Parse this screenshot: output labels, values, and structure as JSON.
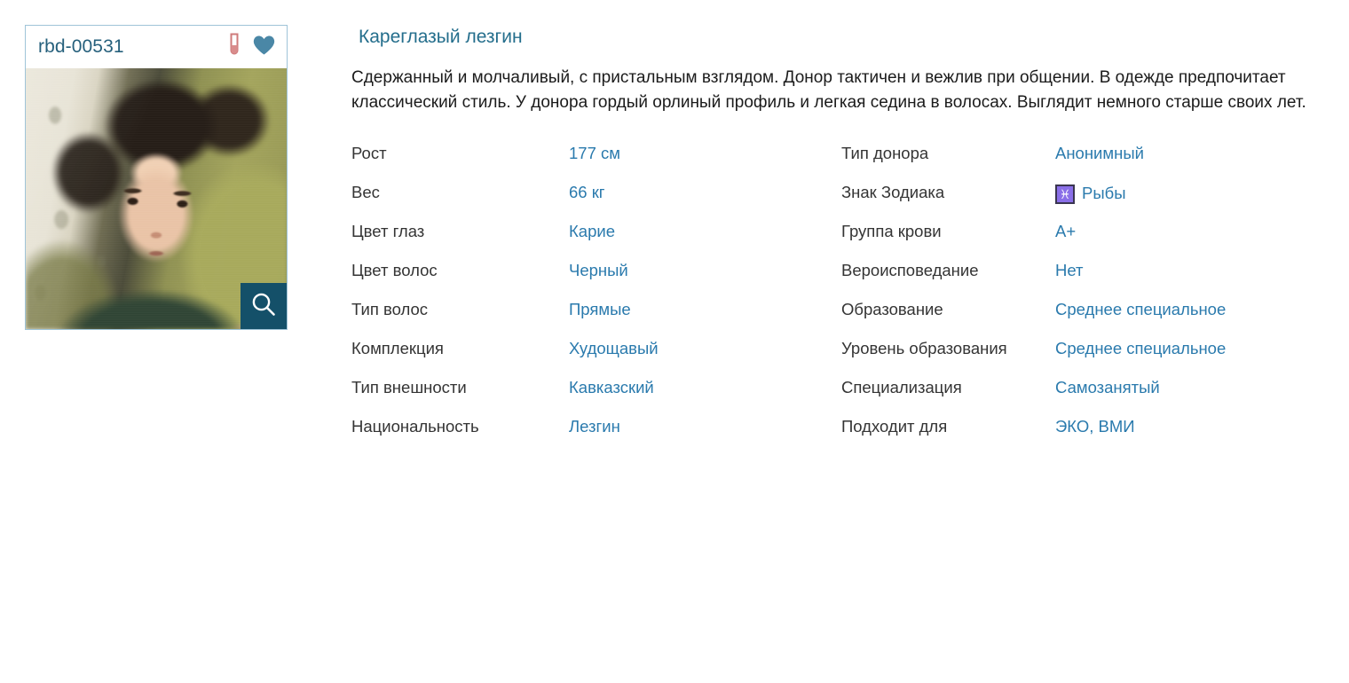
{
  "card": {
    "donor_id": "rbd-00531",
    "tube_icon": "test-tube-icon",
    "heart_icon": "heart-icon",
    "search_icon": "magnifier-icon",
    "photo_alt": "donor childhood photo"
  },
  "details": {
    "title": "Кареглазый лезгин",
    "description": "Сдержанный и молчаливый, с пристальным взглядом. Донор тактичен и вежлив при общении. В одежде предпочитает классический стиль. У донора гордый орлиный профиль и легкая седина в волосах. Выглядит немного старше своих лет."
  },
  "attributes_left": [
    {
      "label": "Рост",
      "value": "177 см"
    },
    {
      "label": "Вес",
      "value": "66 кг"
    },
    {
      "label": "Цвет глаз",
      "value": "Карие"
    },
    {
      "label": "Цвет волос",
      "value": "Черный"
    },
    {
      "label": "Тип волос",
      "value": "Прямые"
    },
    {
      "label": "Комплекция",
      "value": "Худощавый"
    },
    {
      "label": "Тип внешности",
      "value": "Кавказский"
    },
    {
      "label": "Национальность",
      "value": "Лезгин"
    }
  ],
  "attributes_right": [
    {
      "label": "Тип донора",
      "value": "Анонимный"
    },
    {
      "label": "Знак Зодиака",
      "value": "Рыбы",
      "badge": "♓",
      "badge_name": "zodiac-pisces-icon"
    },
    {
      "label": "Группа крови",
      "value": "A+"
    },
    {
      "label": "Вероисповедание",
      "value": "Нет"
    },
    {
      "label": "Образование",
      "value": "Среднее специальное"
    },
    {
      "label": "Уровень образования",
      "value": "Среднее специальное"
    },
    {
      "label": "Специализация",
      "value": "Самозанятый"
    },
    {
      "label": "Подходит для",
      "value": "ЭКО, ВМИ"
    }
  ],
  "colors": {
    "accent_value": "#2a7aad",
    "title": "#246e8c",
    "card_border": "#9fc4d8",
    "heart": "#4a87a6",
    "tube": "#cf7b7b",
    "search_button": "#145069",
    "zodiac_badge": "#8a6fe8"
  }
}
